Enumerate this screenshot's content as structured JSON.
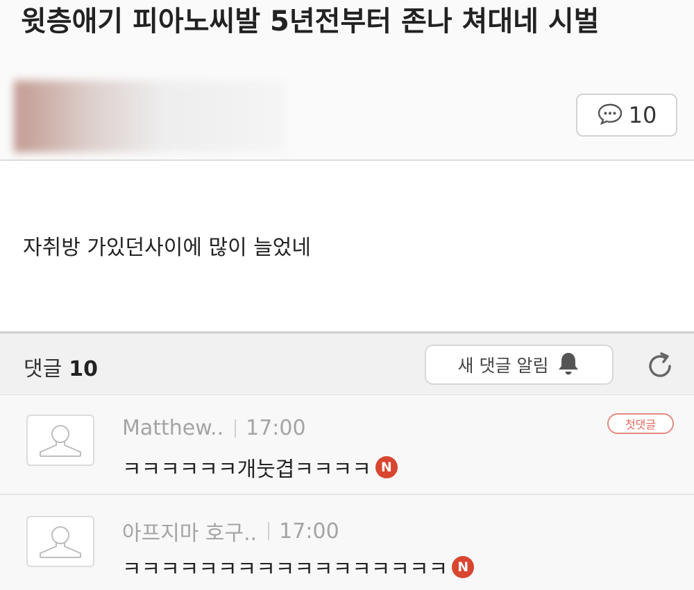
{
  "post": {
    "title": "윗층애기 피아노씨발 5년전부터 존나 쳐대네 시벌",
    "comment_count": "10",
    "body": "자취방 가있던사이에 많이 늘었네"
  },
  "comments_bar": {
    "label": "댓글",
    "count": "10",
    "notify_label": "새 댓글 알림"
  },
  "comments": [
    {
      "author": "Matthew..",
      "time": "17:00",
      "text": "ㅋㅋㅋㅋㅋㅋ개눗겹ㅋㅋㅋㅋ",
      "new_badge": "N",
      "first_badge": "첫댓글"
    },
    {
      "author": "아프지마 호구..",
      "time": "17:00",
      "text": "ㅋㅋㅋㅋㅋㅋㅋㅋㅋㅋㅋㅋㅋㅋㅋㅋㅋ",
      "new_badge": "N"
    }
  ],
  "icons": {
    "comment": "speech-bubble-icon",
    "bell": "bell-icon",
    "refresh": "refresh-icon",
    "avatar": "default-avatar-icon"
  },
  "colors": {
    "new_badge": "#d8462f",
    "first_badge": "#e0675b"
  }
}
